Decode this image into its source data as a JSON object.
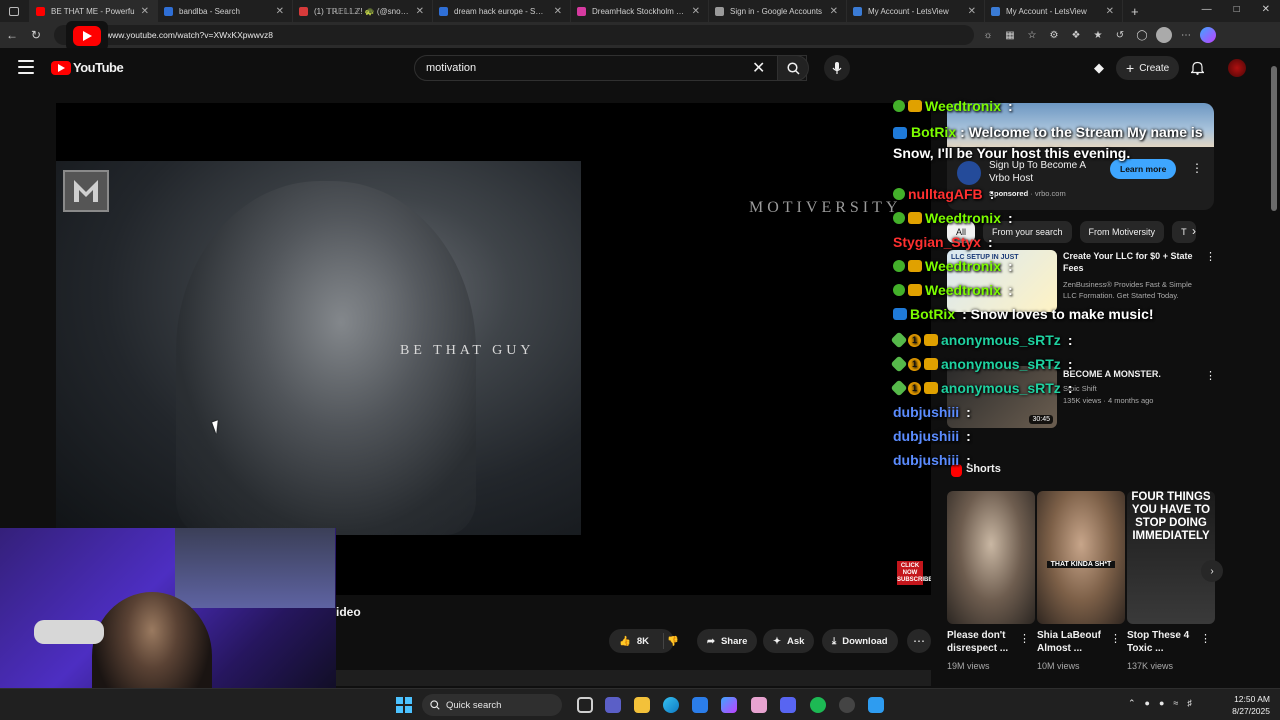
{
  "browser": {
    "tabs": [
      {
        "label": "BE THAT ME - Powerfu",
        "icon_color": "#ff0000",
        "active": true
      },
      {
        "label": "bandlba - Search",
        "icon_color": "#2f6fd6"
      },
      {
        "label": "(1) 𝕋ℝ𝔼𝕃𝕃ℤ! 🐢 (@snowbe",
        "icon_color": "#d63a3a"
      },
      {
        "label": "dream hack europe - Search",
        "icon_color": "#2f6fd6"
      },
      {
        "label": "DreamHack Stockholm 202",
        "icon_color": "#d63aa0"
      },
      {
        "label": "Sign in - Google Accounts",
        "icon_color": "#9a9a9a"
      },
      {
        "label": "My Account - LetsView",
        "icon_color": "#3a7bd5"
      },
      {
        "label": "My Account - LetsView",
        "icon_color": "#3a7bd5"
      }
    ],
    "url": "www.youtube.com/watch?v=XWxKXpwwvz8"
  },
  "youtube": {
    "logo_text": "YouTube",
    "search_value": "motivation",
    "create_label": "Create"
  },
  "player": {
    "frame_text": "BE THAT GUY",
    "watermark": "MOTIVERSITY",
    "click_now": "CLICK NOW SUBSCRIBE"
  },
  "actions": {
    "title_fragment": "ideo",
    "likes": "8K",
    "share": "Share",
    "ask": "Ask",
    "download": "Download"
  },
  "ad": {
    "title": "Sign Up To Become A Vrbo Host",
    "sponsored": "Sponsored",
    "domain": "vrbo.com",
    "learn_more": "Learn more"
  },
  "chips": [
    "All",
    "From your search",
    "From Motiversity",
    "T"
  ],
  "recommendations": [
    {
      "title": "Create Your LLC for $0 + State Fees",
      "sub1": "ZenBusiness® Provides Fast & Simple LLC Formation. Get Started Today.",
      "sub2": "",
      "duration": "",
      "thumb_text": "LLC SETUP IN JUST"
    },
    {
      "title": "BECOME A MONSTER.",
      "sub1": "Stoic Shift",
      "sub2": "135K views · 4 months ago",
      "duration": "30:45",
      "thumb_text": ""
    }
  ],
  "shorts": {
    "label": "Shorts",
    "items": [
      {
        "title": "Please don't disrespect ...",
        "views": "19M views",
        "thumb_text": ""
      },
      {
        "title": "Shia LaBeouf Almost ...",
        "views": "10M views",
        "thumb_text": "THAT KINDA SH*T"
      },
      {
        "title": "Stop These 4 Toxic ...",
        "views": "137K views",
        "thumb_text": "FOUR THINGS YOU HAVE TO STOP DOING IMMEDIATELY"
      }
    ]
  },
  "chat": [
    {
      "user": "Weedtronix",
      "color": "#7cfc00",
      "badges": [
        "chk",
        "crown"
      ],
      "text": ":"
    },
    {
      "user": "BotRix",
      "color": "#7cfc00",
      "badges": [
        "bot"
      ],
      "text": ": Welcome to the Stream My name is Snow, I'll be Your host this evening."
    },
    {
      "user": "nulltagAFB",
      "color": "#ff3030",
      "badges": [
        "chk"
      ],
      "text": ":"
    },
    {
      "user": "Weedtronix",
      "color": "#7cfc00",
      "badges": [
        "chk",
        "crown"
      ],
      "text": ":"
    },
    {
      "user": "Stygian_Styx",
      "color": "#ff3030",
      "badges": [],
      "text": ":"
    },
    {
      "user": "Weedtronix",
      "color": "#7cfc00",
      "badges": [
        "chk",
        "crown"
      ],
      "text": ":"
    },
    {
      "user": "Weedtronix",
      "color": "#7cfc00",
      "badges": [
        "chk",
        "crown"
      ],
      "text": ":"
    },
    {
      "user": "BotRix",
      "color": "#7cfc00",
      "badges": [
        "bot"
      ],
      "text": ": Snow loves to make music!"
    },
    {
      "user": "anonymous_sRTz",
      "color": "#1fd1a0",
      "badges": [
        "gem",
        "num",
        "crown"
      ],
      "text": ":"
    },
    {
      "user": "anonymous_sRTz",
      "color": "#1fd1a0",
      "badges": [
        "gem",
        "num",
        "crown"
      ],
      "text": ":"
    },
    {
      "user": "anonymous_sRTz",
      "color": "#1fd1a0",
      "badges": [
        "gem",
        "num",
        "crown"
      ],
      "text": ":"
    },
    {
      "user": "dubjushiii",
      "color": "#5b8cff",
      "badges": [],
      "text": ":"
    },
    {
      "user": "dubjushiii",
      "color": "#5b8cff",
      "badges": [],
      "text": ":"
    },
    {
      "user": "dubjushiii",
      "color": "#5b8cff",
      "badges": [],
      "text": ":"
    }
  ],
  "taskbar": {
    "search_placeholder": "Quick search",
    "time": "12:50 AM",
    "date": "8/27/2025"
  }
}
